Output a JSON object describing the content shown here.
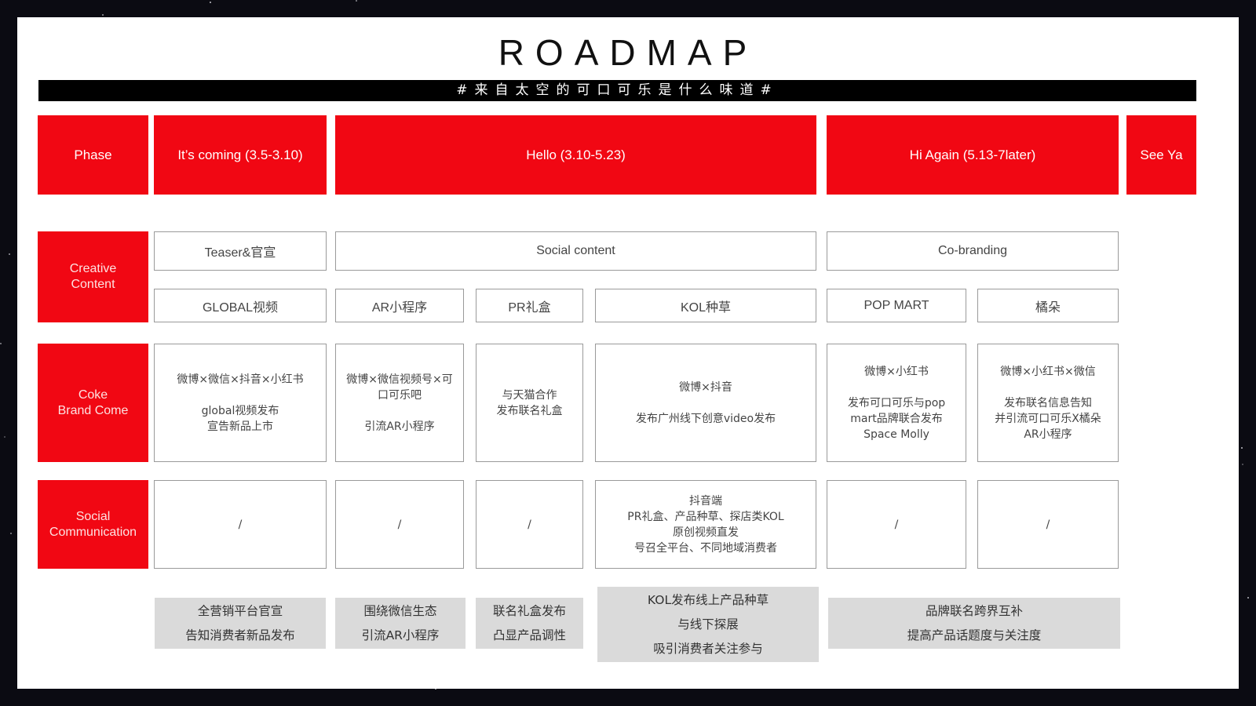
{
  "title": "ROADMAP",
  "banner": "#来自太空的可口可乐是什么味道#",
  "phase_row": {
    "label": "Phase",
    "phases": [
      "It’s coming (3.5-3.10)",
      "Hello (3.10-5.23)",
      "Hi Again (5.13-7later)",
      "See Ya"
    ]
  },
  "rows": {
    "creative": "Creative\nContent",
    "brand": "Coke\nBrand Come",
    "social": "Social\nCommunication"
  },
  "creative_categories": [
    "Teaser&官宣",
    "Social content",
    "Co-branding"
  ],
  "creative_items": [
    "GLOBAL视频",
    "AR小程序",
    "PR礼盒",
    "KOL种草",
    "POP MART",
    "橘朵"
  ],
  "brand_cells": [
    {
      "top": "微博×微信×抖音×小红书",
      "bottom": "global视频发布\n宣告新品上市"
    },
    {
      "top": "微博×微信视频号×可\n口可乐吧",
      "bottom": "引流AR小程序"
    },
    {
      "top": "",
      "bottom": "与天猫合作\n发布联名礼盒"
    },
    {
      "top": "微博×抖音",
      "bottom": "发布广州线下创意video发布"
    },
    {
      "top": "微博×小红书",
      "bottom": "发布可口可乐与pop\nmart品牌联合发布\nSpace Molly"
    },
    {
      "top": "微博×小红书×微信",
      "bottom": "发布联名信息告知\n并引流可口可乐X橘朵\nAR小程序"
    }
  ],
  "social_cells": [
    "/",
    "/",
    "/",
    "抖音端\nPR礼盒、产品种草、探店类KOL\n原创视频直发\n号召全平台、不同地域消费者",
    "/",
    "/"
  ],
  "summaries": [
    [
      "全营销平台官宣",
      "告知消费者新品发布"
    ],
    [
      "围绕微信生态",
      "引流AR小程序"
    ],
    [
      "联名礼盒发布",
      "凸显产品调性"
    ],
    [
      "KOL发布线上产品种草",
      "与线下探展",
      "吸引消费者关注参与"
    ],
    [
      "品牌联名跨界互补",
      "提高产品话题度与关注度"
    ]
  ],
  "colors": {
    "accent_red": "#f10713",
    "banner_black": "#000000",
    "summary_gray": "#dadada"
  }
}
